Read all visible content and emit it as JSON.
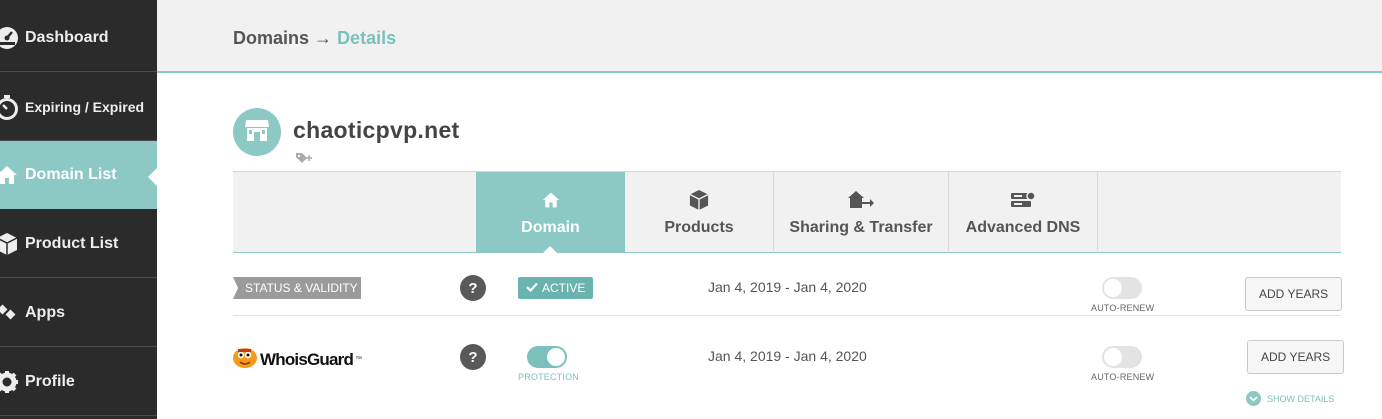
{
  "sidebar": {
    "items": [
      {
        "label": "Dashboard",
        "icon": "dashboard-icon"
      },
      {
        "label": "Expiring / Expired",
        "icon": "stopwatch-icon"
      },
      {
        "label": "Domain List",
        "icon": "home-icon",
        "active": true
      },
      {
        "label": "Product List",
        "icon": "box-icon"
      },
      {
        "label": "Apps",
        "icon": "apps-icon"
      },
      {
        "label": "Profile",
        "icon": "gear-icon"
      }
    ]
  },
  "header": {
    "breadcrumb_root": "Domains",
    "breadcrumb_arrow": "→",
    "breadcrumb_current": "Details"
  },
  "domain": {
    "name": "chaoticpvp.net"
  },
  "tabs": [
    {
      "label": "Domain",
      "icon": "home-icon",
      "active": true
    },
    {
      "label": "Products",
      "icon": "box-icon"
    },
    {
      "label": "Sharing & Transfer",
      "icon": "transfer-icon"
    },
    {
      "label": "Advanced DNS",
      "icon": "server-icon"
    }
  ],
  "rows": {
    "status": {
      "label": "STATUS & VALIDITY",
      "help": "?",
      "badge": "ACTIVE",
      "dates": "Jan 4, 2019 - Jan 4, 2020",
      "autorenew_label": "AUTO-RENEW",
      "autorenew_on": false,
      "button": "ADD YEARS"
    },
    "whoisguard": {
      "brand": "WhoisGuard",
      "tm": "™",
      "help": "?",
      "protection_label": "PROTECTION",
      "protection_on": true,
      "dates": "Jan 4, 2019 - Jan 4, 2020",
      "autorenew_label": "AUTO-RENEW",
      "autorenew_on": false,
      "button": "ADD YEARS",
      "show_details": "SHOW DETAILS"
    }
  },
  "colors": {
    "accent": "#8cc8c4",
    "sidebar_bg": "#2b2b2b",
    "header_bg": "#f1f1f1"
  }
}
